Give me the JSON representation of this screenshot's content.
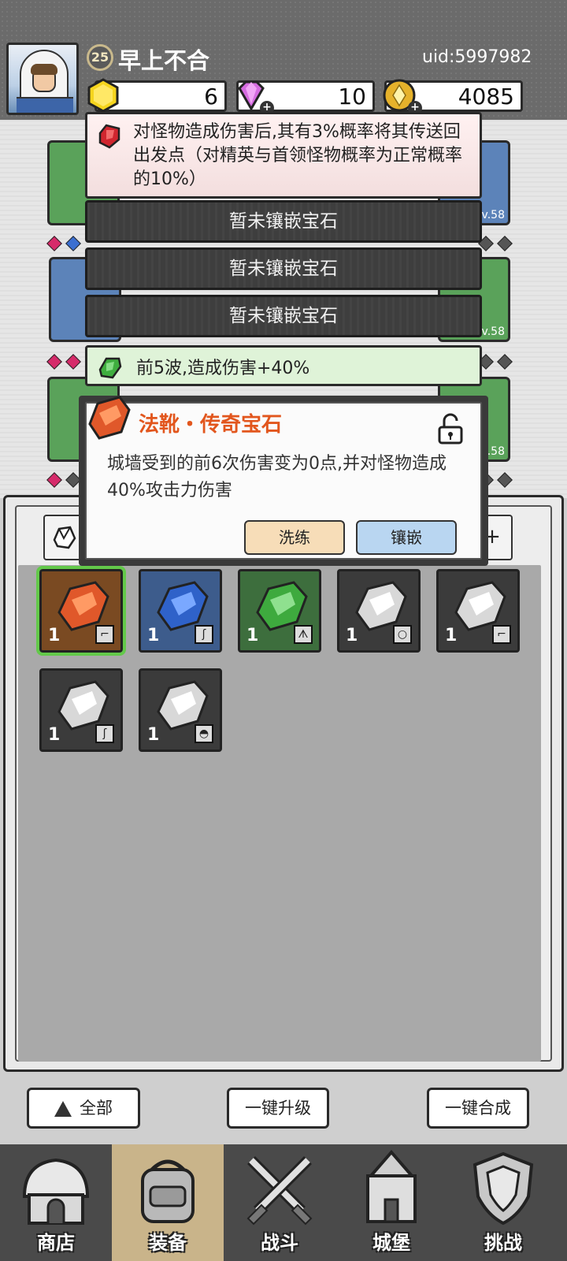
{
  "player": {
    "level": "25",
    "name": "早上不合",
    "uid": "uid:5997982"
  },
  "resources": {
    "coins_small": "6",
    "gems": "10",
    "gold": "4085"
  },
  "equipment": {
    "levels": [
      "Lv.58",
      "Lv.58",
      "Lv.58"
    ]
  },
  "gem_slots": {
    "slot1_text": "对怪物造成伤害后,其有3%概率将其传送回出发点（对精英与首领怪物概率为正常概率的10%）",
    "empty_label": "暂未镶嵌宝石",
    "slot5_text": "前5波,造成伤害+40%"
  },
  "popup": {
    "title": "法靴・传奇宝石",
    "description": "城墙受到的前6次伤害变为0点,并对怪物造成40%攻击力伤害",
    "reforge_label": "洗练",
    "inlay_label": "镶嵌"
  },
  "inventory": {
    "tab_extra": "+",
    "gems": [
      {
        "color": "orange",
        "count": "1",
        "type": "boot"
      },
      {
        "color": "blue",
        "count": "1",
        "type": "staff"
      },
      {
        "color": "green",
        "count": "1",
        "type": "armor"
      },
      {
        "color": "gray",
        "count": "1",
        "type": "ring"
      },
      {
        "color": "gray",
        "count": "1",
        "type": "boot"
      },
      {
        "color": "gray",
        "count": "1",
        "type": "staff"
      },
      {
        "color": "gray",
        "count": "1",
        "type": "helmet"
      }
    ]
  },
  "actions": {
    "all_label": "全部",
    "upgrade_label": "一键升级",
    "merge_label": "一键合成"
  },
  "nav": {
    "items": [
      "商店",
      "装备",
      "战斗",
      "城堡",
      "挑战"
    ],
    "active": "装备"
  },
  "colors": {
    "legendary_orange": "#e2561d",
    "selected_outline": "#63c94a",
    "nav_active": "#c9b48a"
  }
}
